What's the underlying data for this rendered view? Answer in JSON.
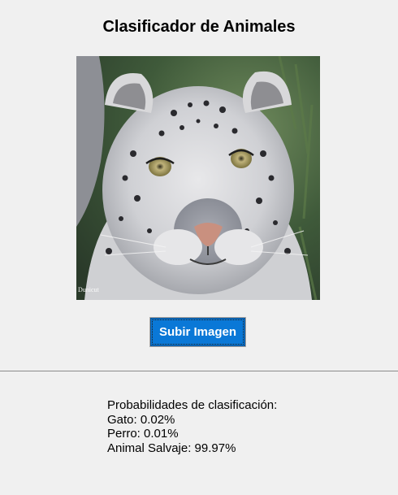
{
  "app": {
    "title": "Clasificador de Animales"
  },
  "image": {
    "subject": "snow-leopard-photo",
    "watermark": "Dunicut"
  },
  "upload_button": {
    "label": "Subir Imagen"
  },
  "results": {
    "heading": "Probabilidades de clasificación:",
    "items": [
      {
        "label": "Gato: 0.02%"
      },
      {
        "label": "Perro: 0.01%"
      },
      {
        "label": "Animal Salvaje: 99.97%"
      }
    ]
  },
  "colors": {
    "background": "#f0f0f0",
    "button": "#0a78d7",
    "button_text": "#ffffff",
    "divider": "#8a8a8a"
  }
}
